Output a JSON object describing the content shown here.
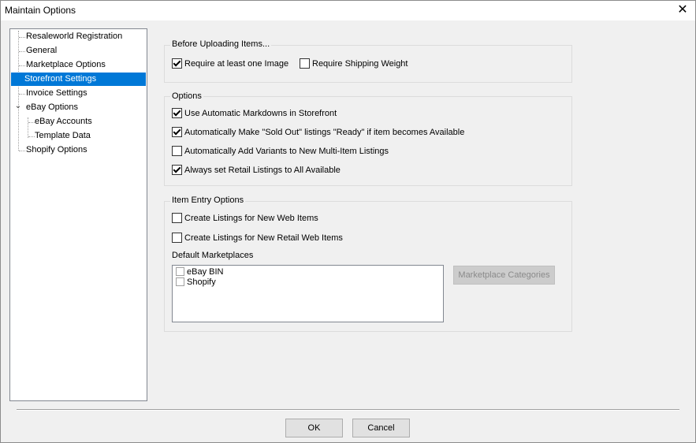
{
  "window": {
    "title": "Maintain Options",
    "close_glyph": "✕"
  },
  "tree": {
    "items": [
      {
        "label": "Resaleworld Registration"
      },
      {
        "label": "General"
      },
      {
        "label": "Marketplace Options"
      },
      {
        "label": "Storefront Settings",
        "selected": true
      },
      {
        "label": "Invoice Settings"
      },
      {
        "label": "eBay Options",
        "expanded": true
      },
      {
        "label": "eBay Accounts"
      },
      {
        "label": "Template Data"
      },
      {
        "label": "Shopify Options"
      }
    ],
    "expander_glyph": "⌄"
  },
  "before_uploading": {
    "label": "Before Uploading Items...",
    "require_image": {
      "label": "Require at least one Image",
      "checked": true
    },
    "require_weight": {
      "label": "Require Shipping Weight",
      "checked": false
    }
  },
  "options": {
    "label": "Options",
    "items": [
      {
        "label": "Use Automatic Markdowns in Storefront",
        "checked": true
      },
      {
        "label": "Automatically Make \"Sold Out\" listings \"Ready\" if item becomes Available",
        "checked": true
      },
      {
        "label": "Automatically Add Variants to New Multi-Item Listings",
        "checked": false
      },
      {
        "label": "Always set Retail Listings to All Available",
        "checked": true
      }
    ]
  },
  "item_entry": {
    "label": "Item Entry Options",
    "create_web": {
      "label": "Create Listings for New Web Items",
      "checked": false
    },
    "create_retail": {
      "label": "Create Listings for New Retail Web Items",
      "checked": false
    },
    "default_marketplaces_label": "Default Marketplaces",
    "marketplaces": [
      {
        "label": "eBay BIN",
        "checked": false
      },
      {
        "label": "Shopify",
        "checked": false
      }
    ],
    "marketplace_categories_button": "Marketplace Categories"
  },
  "footer": {
    "ok": "OK",
    "cancel": "Cancel"
  }
}
